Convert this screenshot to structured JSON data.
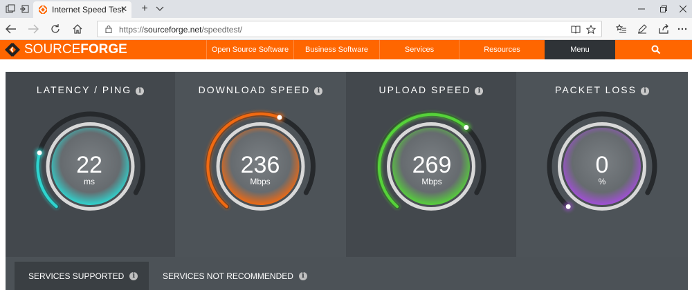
{
  "browser": {
    "tab_title": "Internet Speed Test - HT",
    "url_prefix": "https://",
    "url_host": "sourceforge.net",
    "url_path": "/speedtest/"
  },
  "sourceforge": {
    "logo_light": "SOURCE",
    "logo_bold": "FORGE",
    "nav": [
      "Open Source Software",
      "Business Software",
      "Services",
      "Resources",
      "Menu"
    ],
    "brand_color": "#ff6600"
  },
  "metrics": [
    {
      "title": "LATENCY / PING",
      "value": "22",
      "unit": "ms",
      "color": "#2fd4cf",
      "level": 0.25
    },
    {
      "title": "DOWNLOAD SPEED",
      "value": "236",
      "unit": "Mbps",
      "color": "#f06a12",
      "level": 0.62
    },
    {
      "title": "UPLOAD SPEED",
      "value": "269",
      "unit": "Mbps",
      "color": "#56d23a",
      "level": 0.7
    },
    {
      "title": "PACKET LOSS",
      "value": "0",
      "unit": "%",
      "color": "#a24fd8",
      "level": 0.0
    }
  ],
  "services": {
    "supported": "SERVICES SUPPORTED",
    "not_recommended": "SERVICES NOT RECOMMENDED"
  }
}
